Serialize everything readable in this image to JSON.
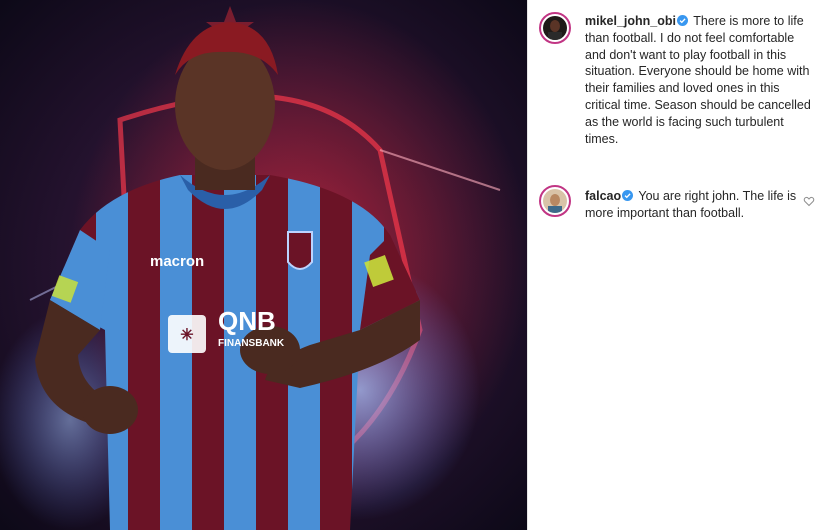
{
  "post": {
    "image_alt": "Player in maroon and blue striped football kit",
    "jersey_sponsor": "QNB",
    "jersey_sponsor_sub": "FINANSBANK",
    "jersey_brand": "macron"
  },
  "caption": {
    "username": "mikel_john_obi",
    "verified": true,
    "text": "There is more to life than football. I do not feel comfortable and don't want to play football in this situation. Everyone should be home with their families and loved ones in this critical time. Season should be cancelled as the world is facing such turbulent times."
  },
  "comments": [
    {
      "username": "falcao",
      "verified": true,
      "text": "You are right john. The life is more important than football."
    }
  ],
  "colors": {
    "verified_blue": "#3897f0",
    "avatar_ring": "#c13584",
    "maroon": "#6b1326",
    "jersey_blue": "#4a8fd6"
  }
}
